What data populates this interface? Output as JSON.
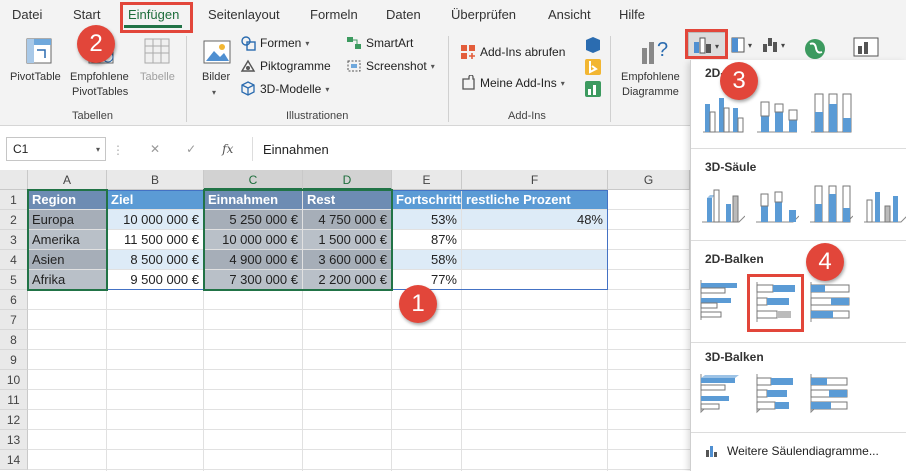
{
  "menu": {
    "tabs": [
      "Datei",
      "Start",
      "Einfügen",
      "Seitenlayout",
      "Formeln",
      "Daten",
      "Überprüfen",
      "Ansicht",
      "Hilfe"
    ],
    "active_tab": "Einfügen"
  },
  "ribbon": {
    "tabellen": {
      "group_label": "Tabellen",
      "pivottable": "PivotTable",
      "empf_pivot_1": "Empfohlene",
      "empf_pivot_2": "PivotTables",
      "tabelle": "Tabelle"
    },
    "illustrationen": {
      "group_label": "Illustrationen",
      "bilder": "Bilder",
      "formen": "Formen",
      "piktogramme": "Piktogramme",
      "modelle": "3D-Modelle",
      "smartart": "SmartArt",
      "screenshot": "Screenshot"
    },
    "addins": {
      "group_label": "Add-Ins",
      "abrufen": "Add-Ins abrufen",
      "meine": "Meine Add-Ins"
    },
    "diagramme": {
      "empf_1": "Empfohlene",
      "empf_2": "Diagramme"
    }
  },
  "formula_bar": {
    "name_box": "C1",
    "fx": "fx",
    "formula": "Einnahmen"
  },
  "sheet": {
    "columns": [
      "A",
      "B",
      "C",
      "D",
      "E",
      "F",
      "G"
    ],
    "rows": [
      "1",
      "2",
      "3",
      "4",
      "5",
      "6",
      "7",
      "8",
      "9",
      "10",
      "11",
      "12",
      "13",
      "14"
    ],
    "headers": [
      "Region",
      "Ziel",
      "Einnahmen",
      "Rest",
      "Fortschritt",
      "restliche Prozent"
    ],
    "data": [
      [
        "Europa",
        "10 000 000 €",
        "5 250 000 €",
        "4 750 000 €",
        "53%",
        "48%"
      ],
      [
        "Amerika",
        "11 500 000 €",
        "10 000 000 €",
        "1 500 000 €",
        "87%",
        ""
      ],
      [
        "Asien",
        "8 500 000 €",
        "4 900 000 €",
        "3 600 000 €",
        "58%",
        ""
      ],
      [
        "Afrika",
        "9 500 000 €",
        "7 300 000 €",
        "2 200 000 €",
        "77%",
        ""
      ]
    ]
  },
  "dropdown": {
    "sec_2d_saeule": "2D-Säule",
    "sec_3d_saeule": "3D-Säule",
    "sec_2d_balken": "2D-Balken",
    "sec_3d_balken": "3D-Balken",
    "more_link": "Weitere Säulendiagramme..."
  },
  "callouts": [
    "1",
    "2",
    "3",
    "4"
  ],
  "colors": {
    "accent_green": "#217346",
    "header_blue": "#5b9bd5",
    "band_blue": "#ddebf7",
    "callout_red": "#e2463a"
  }
}
